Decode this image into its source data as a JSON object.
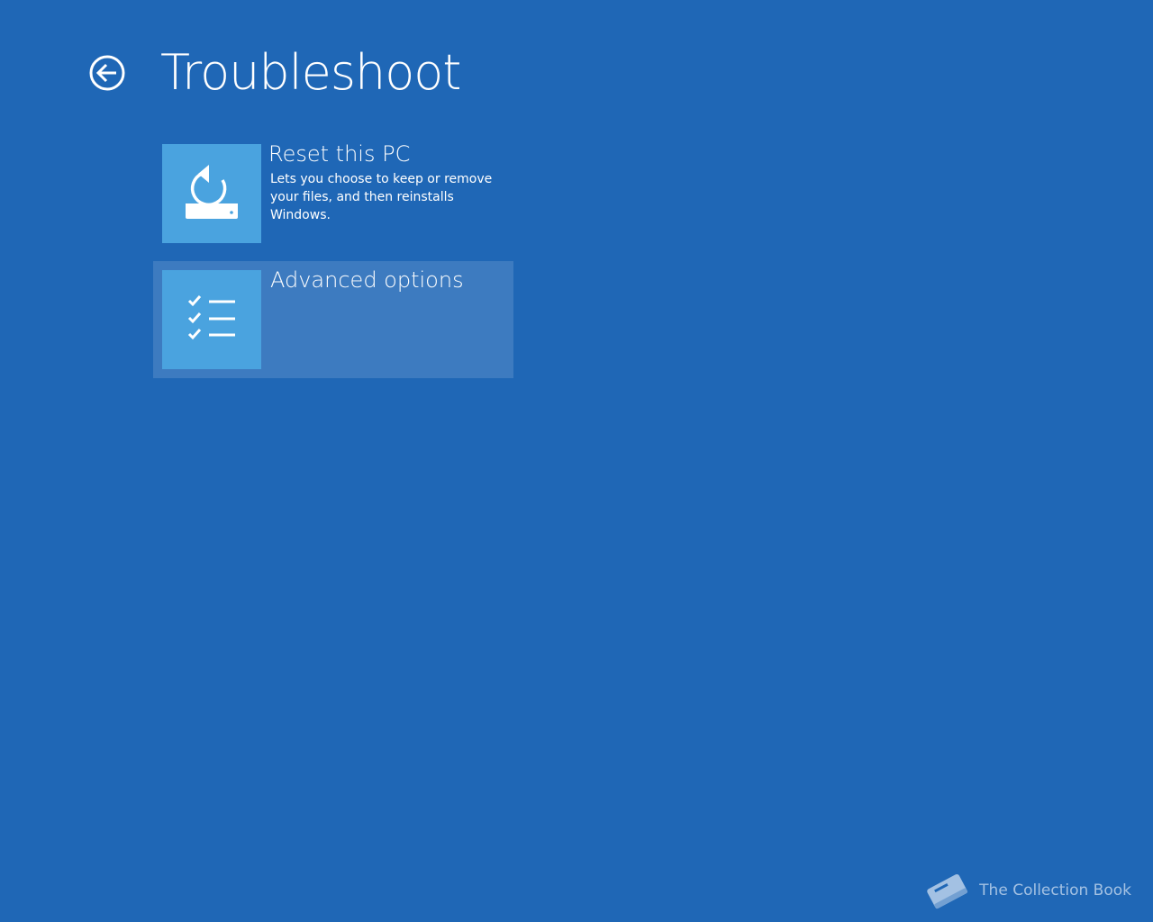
{
  "page": {
    "title": "Troubleshoot",
    "back_icon": "back-arrow-circle-icon",
    "background_color": "#1f67b6"
  },
  "options": [
    {
      "title": "Reset this PC",
      "description": "Lets you choose to keep or remove your files, and then reinstalls Windows.",
      "icon": "reset-pc-icon",
      "highlighted": false
    },
    {
      "title": "Advanced options",
      "description": "",
      "icon": "checklist-icon",
      "highlighted": true
    }
  ],
  "colors": {
    "tile": "#4aa3df",
    "highlight": "#3d7bc0"
  },
  "watermark": {
    "text": "The Collection Book",
    "icon": "book-icon"
  }
}
